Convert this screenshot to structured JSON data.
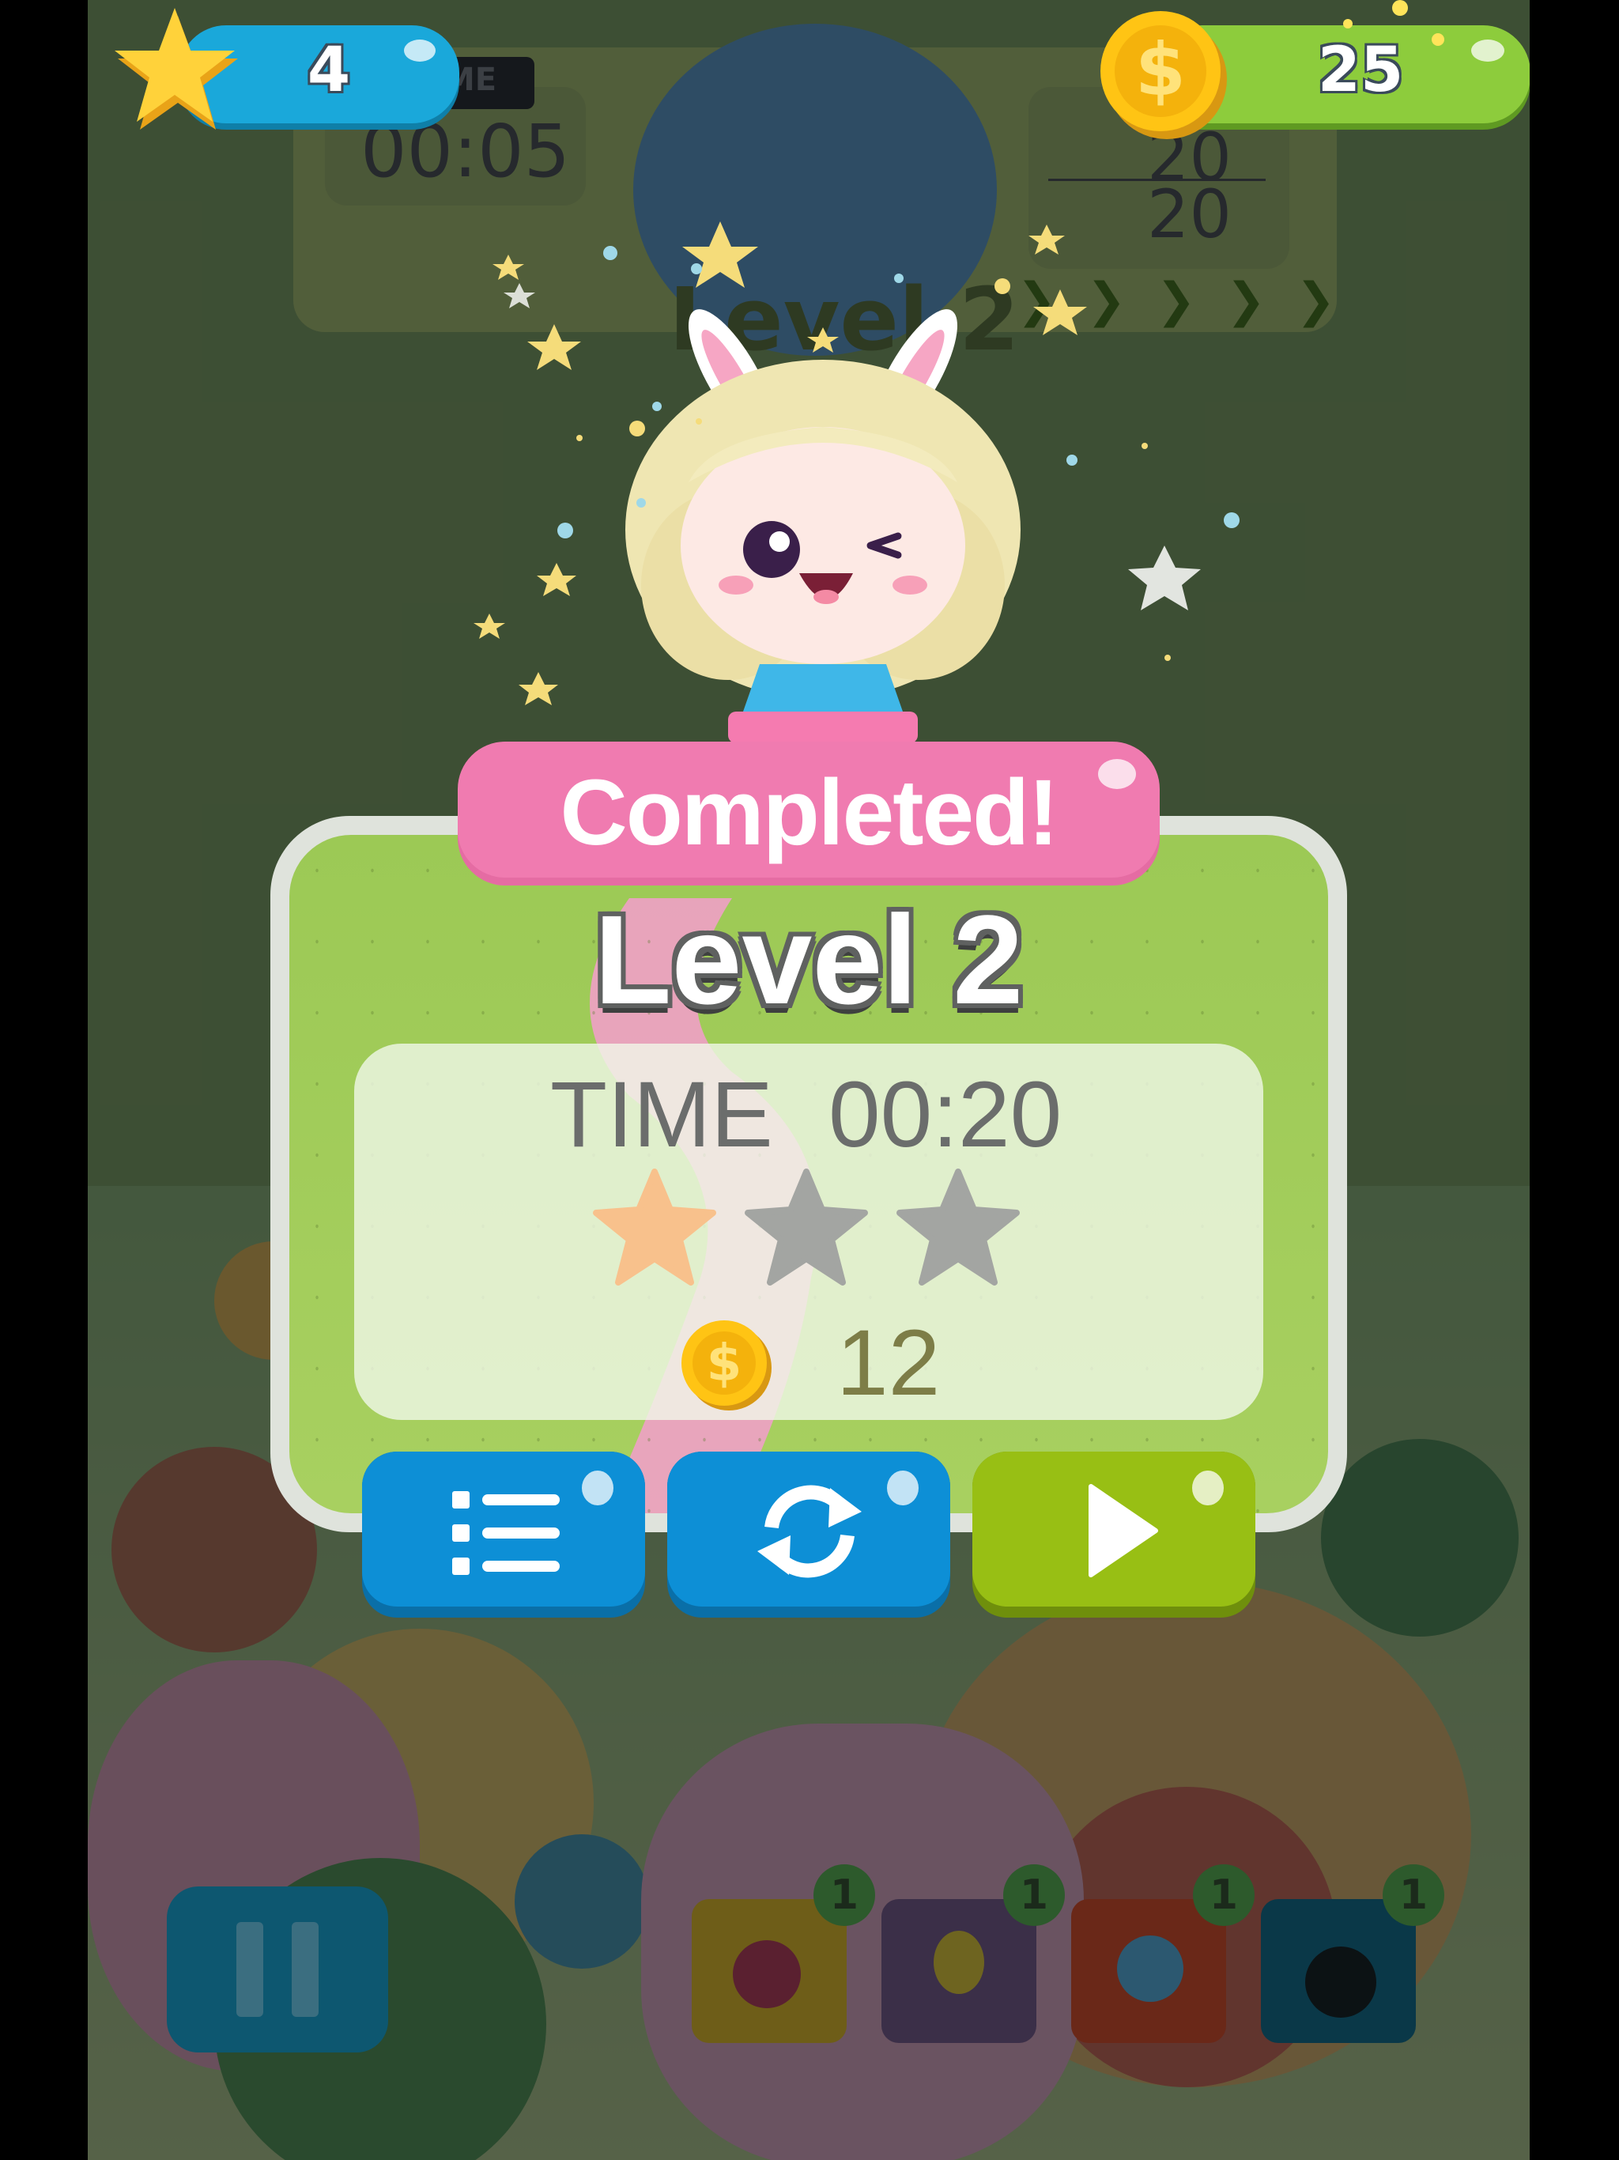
{
  "hud": {
    "lives": "4",
    "coins": "25"
  },
  "background": {
    "time_label_partial": "ME",
    "time_value": "00:05",
    "progress_top": "20",
    "progress_bottom": "20",
    "level_title": "Level 2",
    "powerup_counts": [
      "1",
      "1",
      "1",
      "1"
    ]
  },
  "dialog": {
    "banner": "Completed!",
    "level": "Level 2",
    "time_label": "TIME",
    "time_value": "00:20",
    "stars_earned": 1,
    "stars_total": 3,
    "coins_earned": "12",
    "buttons": {
      "menu": "level-list",
      "replay": "replay",
      "next": "next-level"
    }
  },
  "colors": {
    "banner_pink": "#f07bb0",
    "panel_green": "#a2cc5a",
    "button_blue": "#0d8fd6",
    "button_green": "#98bf14",
    "star_earned": "#f8c18c",
    "star_empty": "#a3a5a2"
  }
}
